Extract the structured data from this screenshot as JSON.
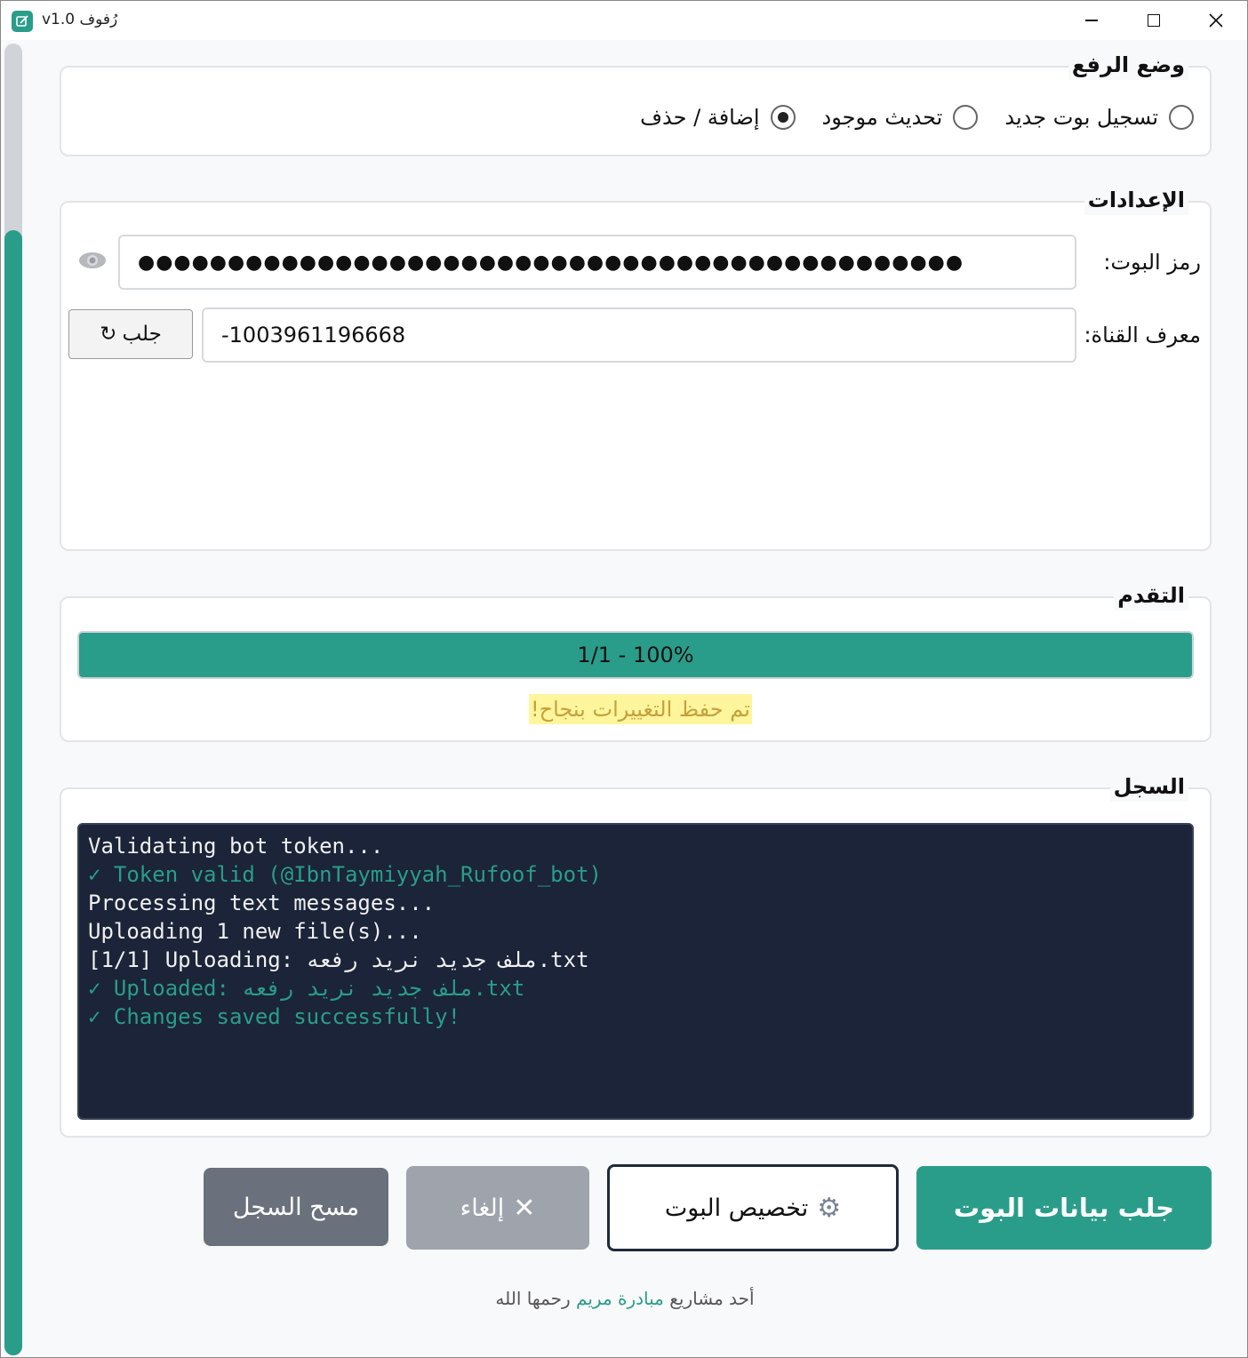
{
  "window": {
    "title": "v1.0 رُفوف"
  },
  "upload_mode": {
    "title": "وضع الرفع",
    "options": [
      {
        "label": "تسجيل بوت جديد",
        "selected": false
      },
      {
        "label": "تحديث موجود",
        "selected": false
      },
      {
        "label": "إضافة / حذف",
        "selected": true
      }
    ]
  },
  "settings": {
    "title": "الإعدادات",
    "token_label": "رمز البوت:",
    "token_value": "●●●●●●●●●●●●●●●●●●●●●●●●●●●●●●●●●●●●●●●●●●●●●●",
    "channel_label": "معرف القناة:",
    "channel_value": "-1003961196668",
    "fetch_label": "جلب",
    "fetch_icon": "↻"
  },
  "progress": {
    "title": "التقدم",
    "text": "1/1 - 100%",
    "fraction": 1.0,
    "status": "تم حفظ التغييرات بنجاح!"
  },
  "log": {
    "title": "السجل",
    "lines": [
      {
        "text": "Validating bot token...",
        "kind": "info"
      },
      {
        "text": "✓ Token valid (@IbnTaymiyyah_Rufoof_bot)",
        "kind": "ok"
      },
      {
        "text": "Processing text messages...",
        "kind": "info"
      },
      {
        "text": "Uploading 1 new file(s)...",
        "kind": "info"
      },
      {
        "text": "[1/1] Uploading: ملف جديد نريد رفعه.txt",
        "kind": "info"
      },
      {
        "text": "✓ Uploaded: ملف جديد نريد رفعه.txt",
        "kind": "ok"
      },
      {
        "text": "✓ Changes saved successfully!",
        "kind": "ok"
      }
    ]
  },
  "buttons": {
    "fetch_bot": "جلب بيانات البوت",
    "customize": "تخصيص البوت",
    "customize_icon": "⚙",
    "cancel": "إلغاء",
    "cancel_icon": "✕",
    "clear_log": "مسح السجل"
  },
  "footer": {
    "prefix": "أحد مشاريع",
    "link": "مبادرة مريم",
    "suffix": "رحمها الله"
  },
  "colors": {
    "accent": "#2a9d8a",
    "log_bg": "#1b2438",
    "status_highlight": "#fff59d"
  }
}
